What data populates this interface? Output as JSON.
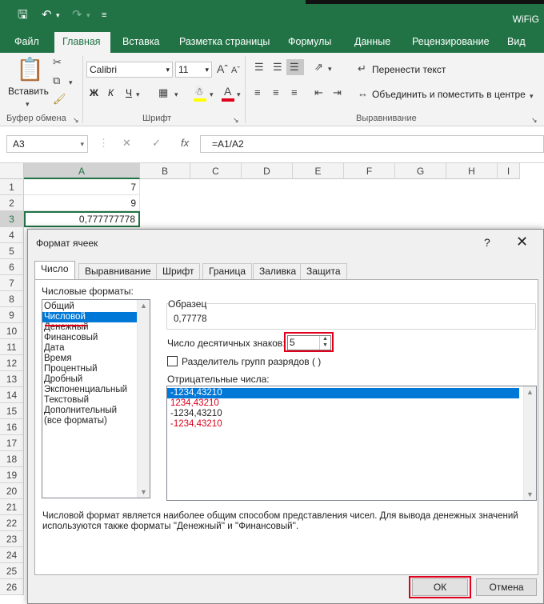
{
  "window": {
    "title_short": "WiFiG"
  },
  "ribbon_tabs": [
    "Файл",
    "Главная",
    "Вставка",
    "Разметка страницы",
    "Формулы",
    "Данные",
    "Рецензирование",
    "Вид"
  ],
  "ribbon": {
    "paste_label": "Вставить",
    "clipboard_group": "Буфер обмена",
    "font_group": "Шрифт",
    "align_group": "Выравнивание",
    "font_name": "Calibri",
    "font_size": "11",
    "bold": "Ж",
    "italic": "К",
    "underline": "Ч",
    "wrap_text": "Перенести текст",
    "merge_center": "Объединить и поместить в центре"
  },
  "formula_bar": {
    "name_box": "A3",
    "fx": "fx",
    "formula": "=A1/A2"
  },
  "sheet": {
    "columns": [
      "A",
      "B",
      "C",
      "D",
      "E",
      "F",
      "G",
      "H",
      "I"
    ],
    "rows": [
      "1",
      "2",
      "3",
      "4",
      "5",
      "6",
      "7",
      "8",
      "9",
      "10",
      "11",
      "12",
      "13",
      "14",
      "15",
      "16",
      "17",
      "18",
      "19",
      "20",
      "21",
      "22",
      "23",
      "24",
      "25",
      "26"
    ],
    "cells": {
      "A1": "7",
      "A2": "9",
      "A3": "0,777777778"
    }
  },
  "dialog": {
    "title": "Формат ячеек",
    "help": "?",
    "close": "✕",
    "tabs": [
      "Число",
      "Выравнивание",
      "Шрифт",
      "Граница",
      "Заливка",
      "Защита"
    ],
    "formats_label": "Числовые форматы:",
    "formats": [
      "Общий",
      "Числовой",
      "Денежный",
      "Финансовый",
      "Дата",
      "Время",
      "Процентный",
      "Дробный",
      "Экспоненциальный",
      "Текстовый",
      "Дополнительный",
      "(все форматы)"
    ],
    "sample_label": "Образец",
    "sample_value": "0,77778",
    "decimals_label": "Число десятичных знаков:",
    "decimals_value": "5",
    "separator_label": "Разделитель групп разрядов ( )",
    "negative_label": "Отрицательные числа:",
    "negative_options": [
      "-1234,43210",
      "1234,43210",
      "-1234,43210",
      "-1234,43210"
    ],
    "description": "Числовой формат является наиболее общим способом представления чисел. Для вывода денежных значений используются также форматы ''Денежный'' и ''Финансовый''.",
    "ok": "ОК",
    "cancel": "Отмена"
  },
  "colors": {
    "excel_green": "#217346",
    "highlight_red": "#e0001b",
    "selection_blue": "#0078d7",
    "negative_red": "#d9001b"
  }
}
